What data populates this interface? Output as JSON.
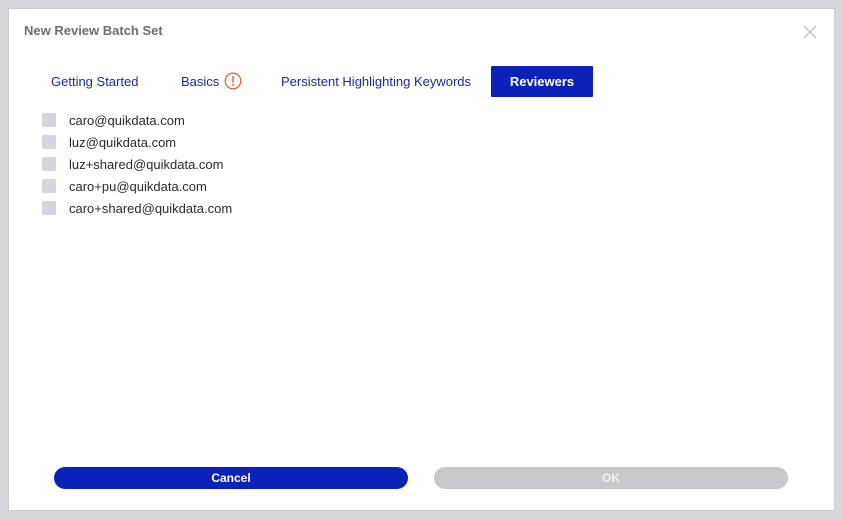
{
  "dialog": {
    "title": "New Review Batch Set"
  },
  "tabs": [
    {
      "label": "Getting Started",
      "active": false
    },
    {
      "label": "Basics",
      "active": false,
      "warning": true
    },
    {
      "label": "Persistent Highlighting Keywords",
      "active": false
    },
    {
      "label": "Reviewers",
      "active": true
    }
  ],
  "reviewers": [
    {
      "email": "caro@quikdata.com",
      "checked": false
    },
    {
      "email": "luz@quikdata.com",
      "checked": false
    },
    {
      "email": "luz+shared@quikdata.com",
      "checked": false
    },
    {
      "email": "caro+pu@quikdata.com",
      "checked": false
    },
    {
      "email": "caro+shared@quikdata.com",
      "checked": false
    }
  ],
  "buttons": {
    "cancel_label": "Cancel",
    "ok_label": "OK"
  },
  "colors": {
    "accent": "#0a22b8",
    "tab_text": "#1a2a9c",
    "warning": "#e8623a",
    "disabled": "#c7c8cb"
  },
  "icons": {
    "close": "close-icon",
    "warning": "warning-circle-icon",
    "checkbox": "checkbox-unchecked-icon"
  }
}
